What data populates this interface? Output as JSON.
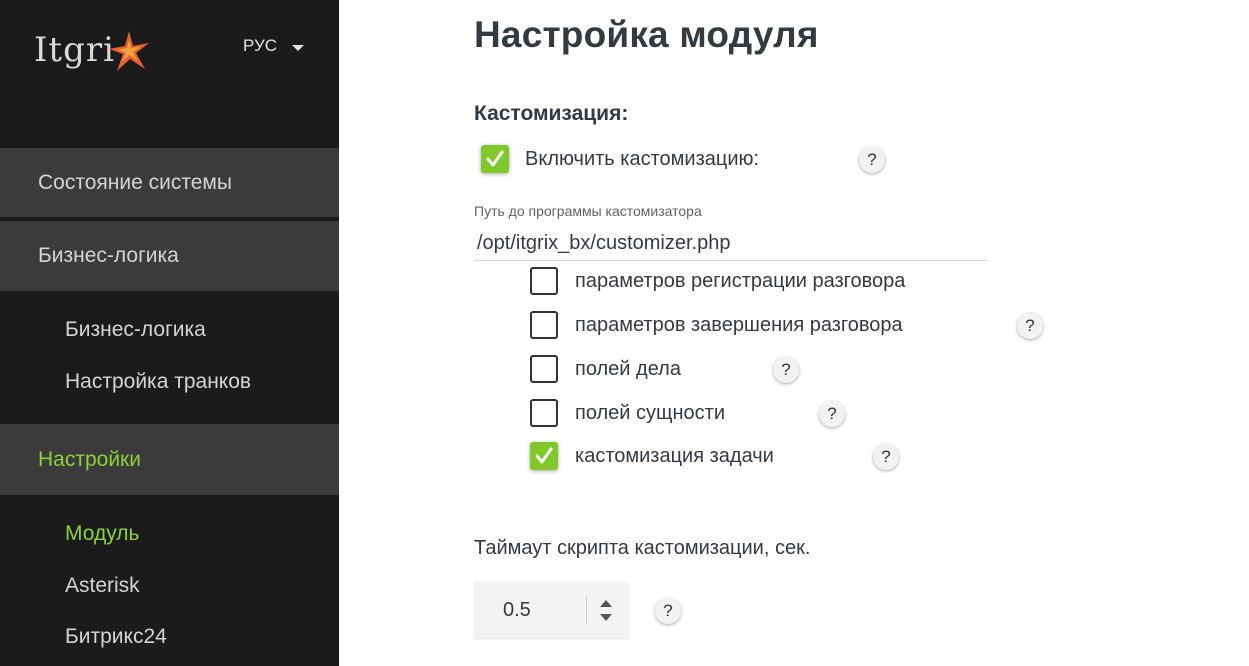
{
  "sidebar": {
    "logo_text": "Itgri",
    "language": "РУС",
    "sections": [
      {
        "label": "Состояние системы"
      },
      {
        "label": "Бизнес-логика"
      },
      {
        "label": "Настройки"
      }
    ],
    "business_sub": [
      {
        "label": "Бизнес-логика"
      },
      {
        "label": "Настройка транков"
      }
    ],
    "settings_sub": [
      {
        "label": "Модуль"
      },
      {
        "label": "Asterisk"
      },
      {
        "label": "Битрикс24"
      }
    ]
  },
  "main": {
    "title": "Настройка модуля",
    "section_title": "Кастомизация:",
    "enable_label": "Включить кастомизацию:",
    "path_label": "Путь до программы кастомизатора",
    "path_value": "/opt/itgrix_bx/customizer.php",
    "options": [
      {
        "label": "параметров регистрации разговора",
        "checked": false
      },
      {
        "label": "параметров завершения разговора",
        "checked": false
      },
      {
        "label": "полей дела",
        "checked": false
      },
      {
        "label": "полей сущности",
        "checked": false
      },
      {
        "label": "кастомизация задачи",
        "checked": true
      }
    ],
    "timeout_label": "Таймаут скрипта кастомизации, сек.",
    "timeout_value": "0.5",
    "help_glyph": "?"
  },
  "colors": {
    "sidebar_bg": "#1b1b1b",
    "section_bg": "#3b3b3b",
    "accent_green": "#8fd037",
    "checkbox_green": "#7fc929",
    "text_dark": "#333a40"
  }
}
